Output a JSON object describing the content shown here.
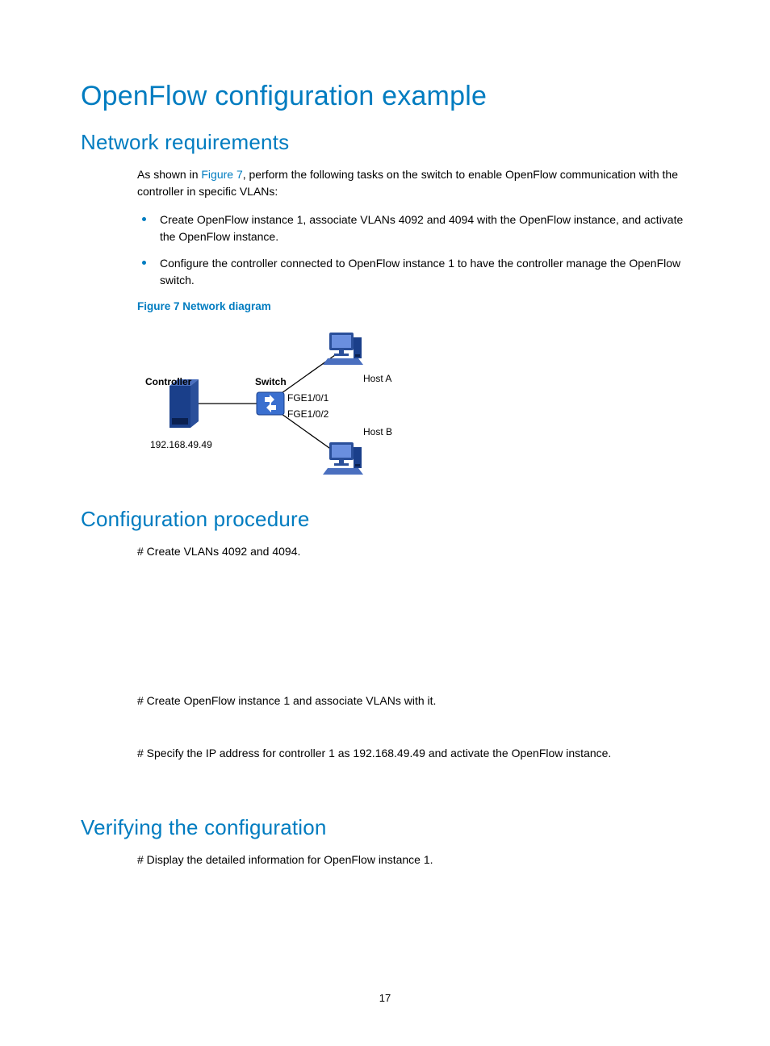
{
  "title": "OpenFlow configuration example",
  "sections": {
    "network_requirements": {
      "heading": "Network requirements",
      "intro_before_link": "As shown in ",
      "intro_link": "Figure 7",
      "intro_after_link": ", perform the following tasks on the switch to enable OpenFlow communication with the controller in specific VLANs:",
      "bullets": [
        "Create OpenFlow instance 1, associate VLANs 4092 and 4094 with the OpenFlow instance, and activate the OpenFlow instance.",
        "Configure the controller connected to OpenFlow instance 1 to have the controller manage the OpenFlow switch."
      ],
      "figure_caption": "Figure 7 Network diagram",
      "diagram": {
        "controller_label": "Controller",
        "switch_label": "Switch",
        "host_a_label": "Host A",
        "host_b_label": "Host B",
        "port1_label": "FGE1/0/1",
        "port2_label": "FGE1/0/2",
        "controller_ip": "192.168.49.49"
      }
    },
    "configuration_procedure": {
      "heading": "Configuration procedure",
      "steps": [
        "# Create VLANs 4092 and 4094.",
        "# Create OpenFlow instance 1 and associate VLANs with it.",
        "# Specify the IP address for controller 1 as 192.168.49.49 and activate the OpenFlow instance."
      ]
    },
    "verifying": {
      "heading": "Verifying the configuration",
      "steps": [
        "# Display the detailed information for OpenFlow instance 1."
      ]
    }
  },
  "page_number": "17"
}
